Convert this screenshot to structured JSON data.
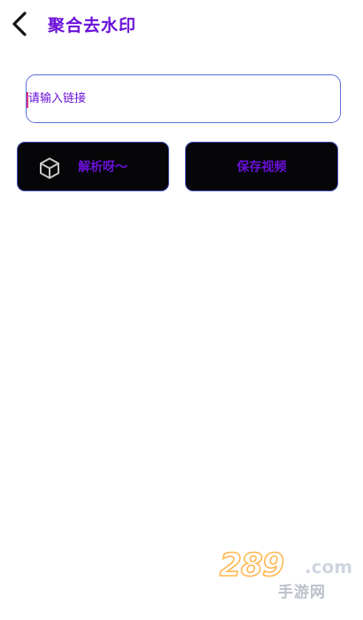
{
  "colors": {
    "accent": "#6a11d8",
    "button_bg": "#060608",
    "button_border": "#3f4fb8",
    "input_border": "#5b6fd6"
  },
  "header": {
    "back_icon": "chevron-left-icon",
    "title": "聚合去水印"
  },
  "input": {
    "placeholder": "请输入链接",
    "value": ""
  },
  "buttons": {
    "parse_label": "解析呀～",
    "parse_icon": "cube-icon",
    "save_label": "保存视频"
  },
  "watermark": {
    "main": "289",
    "dotcom": ".com",
    "sub": "手游网"
  }
}
